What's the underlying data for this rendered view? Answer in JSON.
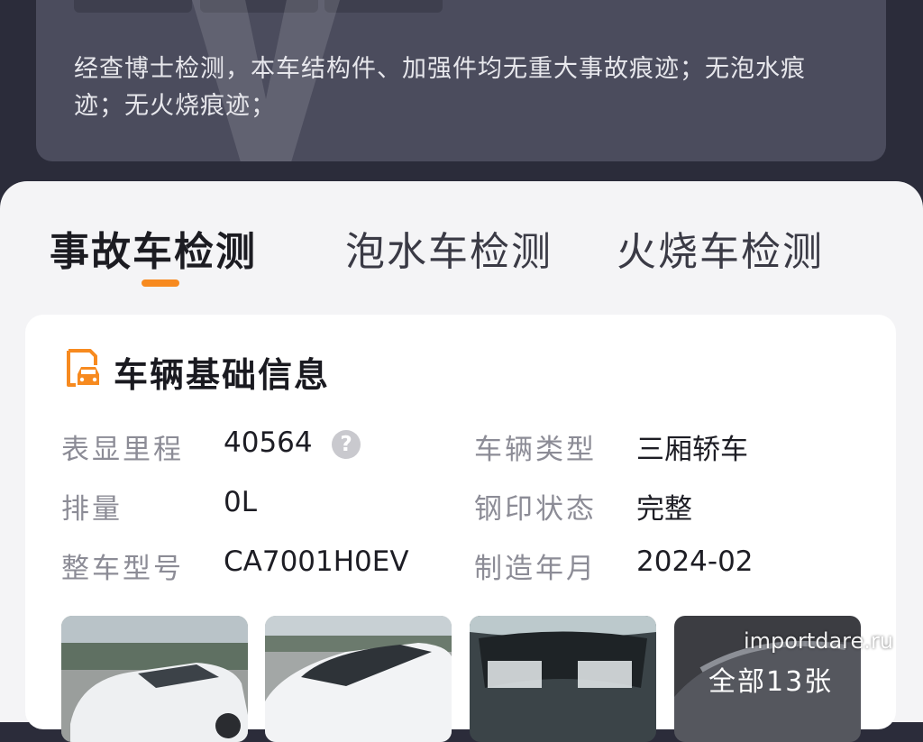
{
  "summary": {
    "text": "经查博士检测，本车结构件、加强件均无重大事故痕迹；无泡水痕迹；无火烧痕迹；"
  },
  "tabs": [
    {
      "label": "事故车检测",
      "active": true
    },
    {
      "label": "泡水车检测",
      "active": false
    },
    {
      "label": "火烧车检测",
      "active": false
    }
  ],
  "accent_color": "#f78a1f",
  "basic_info": {
    "title": "车辆基础信息",
    "icon": "car-document-icon",
    "fields": [
      {
        "label": "表显里程",
        "value": "40564"
      },
      {
        "label": "车辆类型",
        "value": "三厢轿车"
      },
      {
        "label": "排量",
        "value": "0L"
      },
      {
        "label": "钢印状态",
        "value": "完整"
      },
      {
        "label": "整车型号",
        "value": "CA7001H0EV"
      },
      {
        "label": "制造年月",
        "value": "2024-02"
      }
    ],
    "help_glyph": "?"
  },
  "photos": {
    "all_label": "全部13张"
  },
  "watermark": "importdare.ru"
}
